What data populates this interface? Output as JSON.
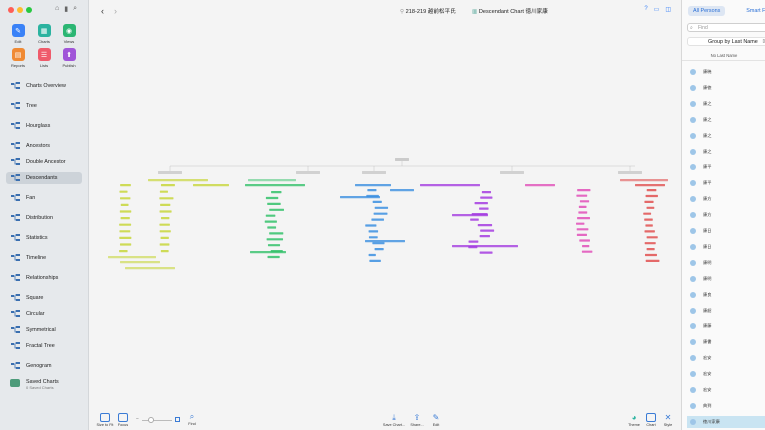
{
  "window": {
    "top_icons": [
      "tag-icon",
      "bookmark-icon",
      "person-search-icon"
    ]
  },
  "sidebar": {
    "grid": [
      {
        "id": "edit",
        "label": "Edit",
        "color": "#3a82f7",
        "glyph": "✎"
      },
      {
        "id": "charts",
        "label": "Charts",
        "color": "#2bb3a0",
        "glyph": "▦"
      },
      {
        "id": "views",
        "label": "Views",
        "color": "#2bb673",
        "glyph": "◉"
      },
      {
        "id": "reports",
        "label": "Reports",
        "color": "#f08a34",
        "glyph": "▤"
      },
      {
        "id": "lists",
        "label": "Lists",
        "color": "#ef5b6b",
        "glyph": "☰"
      },
      {
        "id": "publish",
        "label": "Publish",
        "color": "#a055d8",
        "glyph": "⬆"
      }
    ],
    "nav": [
      {
        "id": "charts-overview",
        "label": "Charts Overview",
        "icon": "charts-overview-icon"
      },
      {
        "id": "tree",
        "label": "Tree",
        "icon": "tree-icon"
      },
      {
        "id": "hourglass",
        "label": "Hourglass",
        "icon": "hourglass-icon"
      },
      {
        "id": "ancestors",
        "label": "Ancestors",
        "icon": "ancestors-icon"
      },
      {
        "id": "double-ancestor",
        "label": "Double Ancestor",
        "icon": "double-ancestor-icon"
      },
      {
        "id": "descendants",
        "label": "Descendants",
        "icon": "descendants-icon"
      },
      {
        "id": "fan",
        "label": "Fan",
        "icon": "fan-icon"
      },
      {
        "id": "distribution",
        "label": "Distribution",
        "icon": "distribution-icon"
      },
      {
        "id": "statistics",
        "label": "Statistics",
        "icon": "statistics-icon"
      },
      {
        "id": "timeline",
        "label": "Timeline",
        "icon": "timeline-icon"
      },
      {
        "id": "relationships",
        "label": "Relationships",
        "icon": "relationships-icon"
      },
      {
        "id": "square",
        "label": "Square",
        "icon": "square-icon"
      },
      {
        "id": "circular",
        "label": "Circular",
        "icon": "circular-icon"
      },
      {
        "id": "symmetrical",
        "label": "Symmetrical",
        "icon": "symmetrical-icon"
      },
      {
        "id": "fractal-tree",
        "label": "Fractal Tree",
        "icon": "fractal-tree-icon"
      },
      {
        "id": "genogram",
        "label": "Genogram",
        "icon": "genogram-icon"
      }
    ],
    "active": "descendants",
    "saved": {
      "label": "Saved Charts",
      "count": "0 Saved Charts"
    }
  },
  "toolbar": {
    "person_label": "218-219 越前松平氏",
    "chart_title": "Descendant Chart 徳川家康",
    "right_icons": [
      "help-icon",
      "window-icon",
      "sidebar-icon"
    ]
  },
  "bottombar": {
    "size_to_fit": "Size to Fit",
    "focus": "Focus",
    "find": "Find",
    "save_chart": "Save Chart...",
    "share": "Share...",
    "edit": "Edit",
    "theme": "Theme",
    "chart": "Chart",
    "style": "Style",
    "zoom_level": 0.3
  },
  "rpanel": {
    "tab_all": "All Persons",
    "tab_smart": "Smart Fil",
    "search_placeholder": "Find",
    "groupby": "Group by Last Name",
    "section": "No Last Name",
    "persons": [
      "康暁",
      "康徳",
      "康之",
      "康之",
      "康之",
      "康之",
      "康平",
      "康平",
      "康方",
      "康方",
      "康日",
      "康日",
      "康明",
      "康明",
      "康良",
      "康韶",
      "康藤",
      "康書",
      "宏安",
      "宏安",
      "宏安",
      "典到",
      "徳川家康"
    ],
    "selected": "徳川家康"
  },
  "chart_colors": {
    "root": "#b9b9b9",
    "branches": [
      "#c7d63b",
      "#33c16a",
      "#3b8fe0",
      "#a43ce0",
      "#e04fb8",
      "#e05050"
    ]
  }
}
